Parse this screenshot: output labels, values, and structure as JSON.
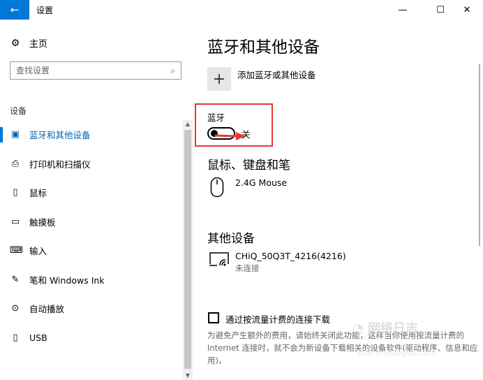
{
  "window": {
    "title": "设置",
    "back_icon": "←",
    "min_icon": "—",
    "max_icon": "☐",
    "close_icon": "✕"
  },
  "sidebar": {
    "home": {
      "icon": "gear-icon",
      "glyph": "⚙",
      "label": "主页"
    },
    "search_placeholder": "查找设置",
    "search_icon": "⌕",
    "section_label": "设备",
    "items": [
      {
        "label": "蓝牙和其他设备",
        "icon": "bluetooth-devices-icon",
        "glyph": "▣",
        "active": true
      },
      {
        "label": "打印机和扫描仪",
        "icon": "printer-icon",
        "glyph": "⎙"
      },
      {
        "label": "鼠标",
        "icon": "mouse-icon",
        "glyph": "▯"
      },
      {
        "label": "触摸板",
        "icon": "touchpad-icon",
        "glyph": "▭"
      },
      {
        "label": "输入",
        "icon": "keyboard-icon",
        "glyph": "⌨"
      },
      {
        "label": "笔和 Windows Ink",
        "icon": "pen-icon",
        "glyph": "✎"
      },
      {
        "label": "自动播放",
        "icon": "autoplay-icon",
        "glyph": "⊙"
      },
      {
        "label": "USB",
        "icon": "usb-icon",
        "glyph": "▯"
      }
    ],
    "scroll_up": "▲",
    "scroll_down": "▼"
  },
  "main": {
    "title": "蓝牙和其他设备",
    "add_icon": "+",
    "add_label": "添加蓝牙或其他设备",
    "bluetooth": {
      "label": "蓝牙",
      "state_label": "关",
      "on": false
    },
    "mouse_section": {
      "title": "鼠标、键盘和笔",
      "device_name": "2.4G Mouse"
    },
    "other_section": {
      "title": "其他设备",
      "device_name": "CHiQ_50Q3T_4216(4216)",
      "device_status": "未连接"
    },
    "metered": {
      "label": "通过按流量计费的连接下载",
      "checked": false,
      "description": "为避免产生额外的费用，请始终关闭此功能，这样当你使用按流量计费的 Internet 连接时，就不会为新设备下载相关的设备软件(驱动程序、信息和应用)。"
    }
  },
  "colors": {
    "accent": "#0078d7",
    "highlight_box": "#e53935"
  }
}
